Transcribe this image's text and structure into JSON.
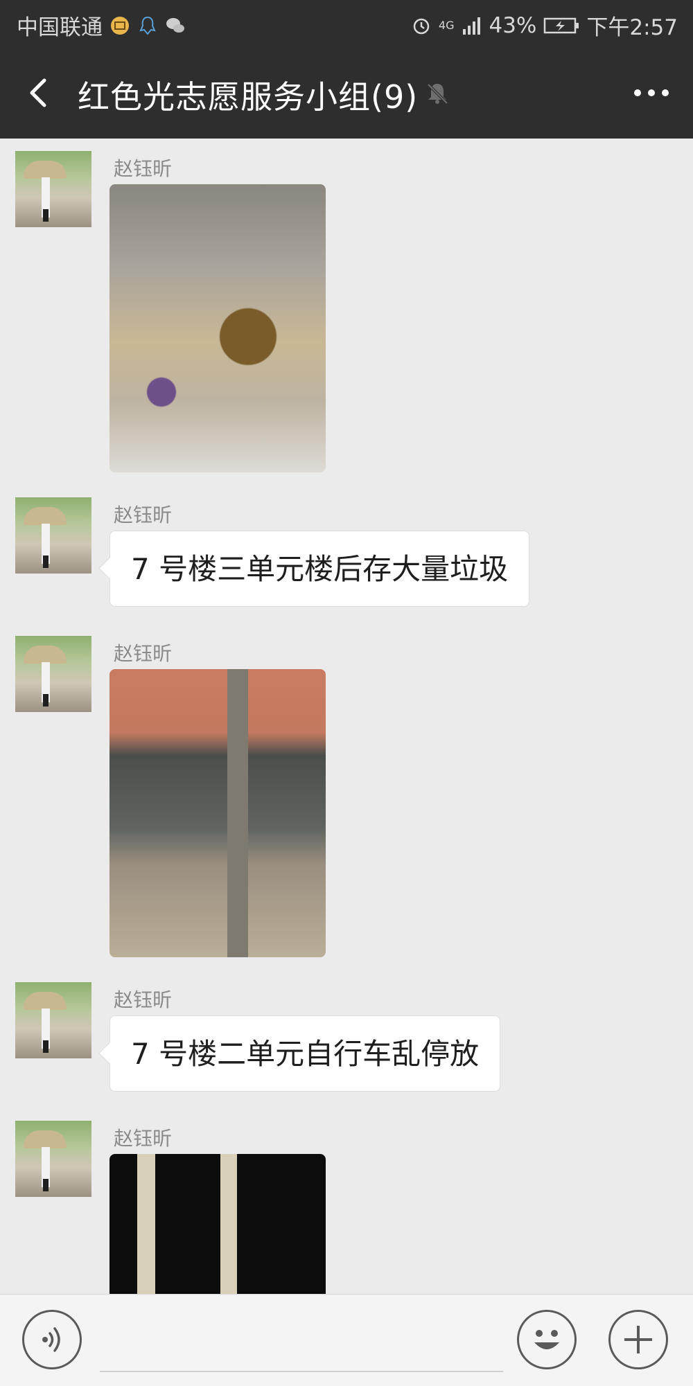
{
  "status_bar": {
    "carrier": "中国联通",
    "network": "4G",
    "battery": "43%",
    "time": "下午2:57"
  },
  "header": {
    "back_icon": "chevron-left-icon",
    "title": "红色光志愿服务小组(9)",
    "mute_icon": "bell-off-icon",
    "more_icon": "more-horizontal-icon"
  },
  "messages": [
    {
      "sender": "赵钰昕",
      "type": "image",
      "content": ""
    },
    {
      "sender": "赵钰昕",
      "type": "text",
      "content": "7 号楼三单元楼后存大量垃圾"
    },
    {
      "sender": "赵钰昕",
      "type": "image",
      "content": ""
    },
    {
      "sender": "赵钰昕",
      "type": "text",
      "content": "7 号楼二单元自行车乱停放"
    },
    {
      "sender": "赵钰昕",
      "type": "image",
      "content": ""
    }
  ],
  "input_bar": {
    "voice_icon": "voice-icon",
    "emoji_icon": "emoji-icon",
    "plus_icon": "plus-icon",
    "text_value": ""
  },
  "colors": {
    "bar_background": "#2e2e2e",
    "chat_background": "#ebebeb",
    "bubble": "#ffffff"
  }
}
